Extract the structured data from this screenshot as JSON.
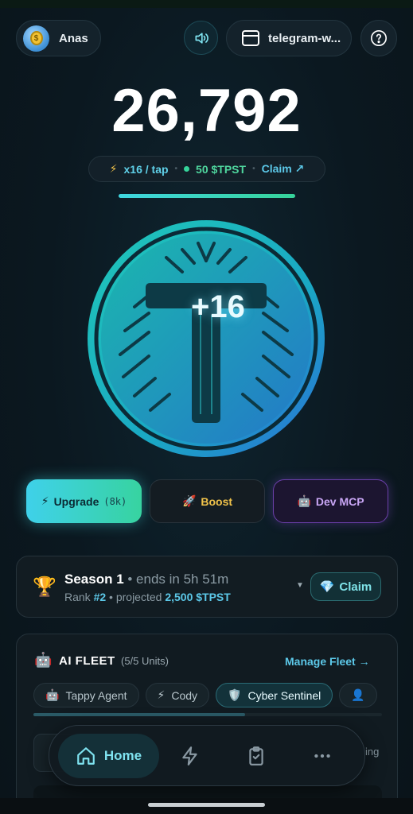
{
  "header": {
    "profile_name": "Anas",
    "telegram_label": "telegram-w...",
    "icons": [
      "speaker-icon",
      "browser-window-icon",
      "help-icon"
    ]
  },
  "score": "26,792",
  "stats": {
    "tap_rate": "x16 / tap",
    "token_amount": "50 $TPST",
    "claim_label": "Claim ↗"
  },
  "progress": {
    "fraction": 1.0
  },
  "coin": {
    "letter": "T",
    "tap_bonus": "+16"
  },
  "actions": {
    "upgrade_label": "Upgrade",
    "upgrade_cost": "(8k)",
    "boost_label": "Boost",
    "dev_label": "Dev MCP"
  },
  "season": {
    "title": "Season 1",
    "ends": " • ends in 5h 51m",
    "rank_prefix": "Rank ",
    "rank_value": "#2",
    "projected_prefix": " • projected ",
    "projected_value": "2,500 $TPST",
    "claim_label": "Claim"
  },
  "fleet": {
    "title": "AI FLEET",
    "units": "(5/5 Units)",
    "manage_label": "Manage Fleet →",
    "tabs": [
      {
        "icon": "🤖",
        "label": "Tappy Agent"
      },
      {
        "icon": "⚡",
        "label": "Cody"
      },
      {
        "icon": "🛡️",
        "label": "Cyber Sentinel"
      },
      {
        "icon": "👤",
        "label": ""
      }
    ],
    "partial_right_text": "ing"
  },
  "nav": {
    "home_label": "Home"
  },
  "colors": {
    "accent_cyan": "#5cc8e8",
    "accent_green": "#36d39a",
    "boost_gold": "#f0c24a",
    "dev_purple": "#c9a6f5"
  }
}
